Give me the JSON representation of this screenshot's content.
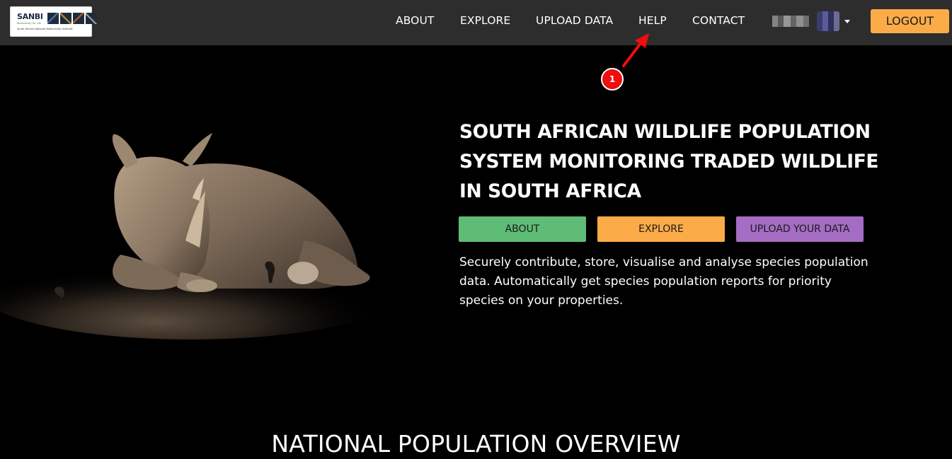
{
  "header": {
    "logo": {
      "wordmark": "SANBI",
      "tagline": "Biodiversity for Life",
      "full_name": "South African National Biodiversity Institute"
    },
    "nav": [
      {
        "label": "ABOUT"
      },
      {
        "label": "EXPLORE"
      },
      {
        "label": "UPLOAD DATA"
      },
      {
        "label": "HELP"
      },
      {
        "label": "CONTACT"
      }
    ],
    "logout_label": "LOGOUT"
  },
  "annotation": {
    "badge": "1",
    "color": "#f00d0d"
  },
  "hero": {
    "title": "SOUTH AFRICAN WILDLIFE POPULATION SYSTEM MONITORING TRADED WILDLIFE IN SOUTH AFRICA",
    "buttons": [
      {
        "label": "ABOUT",
        "color": "#5fbc76"
      },
      {
        "label": "EXPLORE",
        "color": "#fbab48"
      },
      {
        "label": "UPLOAD YOUR DATA",
        "color": "#a46dc3"
      }
    ],
    "description": "Securely contribute, store, visualise and analyse species population data. Automatically get species population reports for priority species on your properties."
  },
  "overview": {
    "title": "NATIONAL POPULATION OVERVIEW"
  },
  "colors": {
    "navbar_bg": "#2d2d2d",
    "page_bg": "#000000",
    "logout_bg": "#fbab48"
  }
}
